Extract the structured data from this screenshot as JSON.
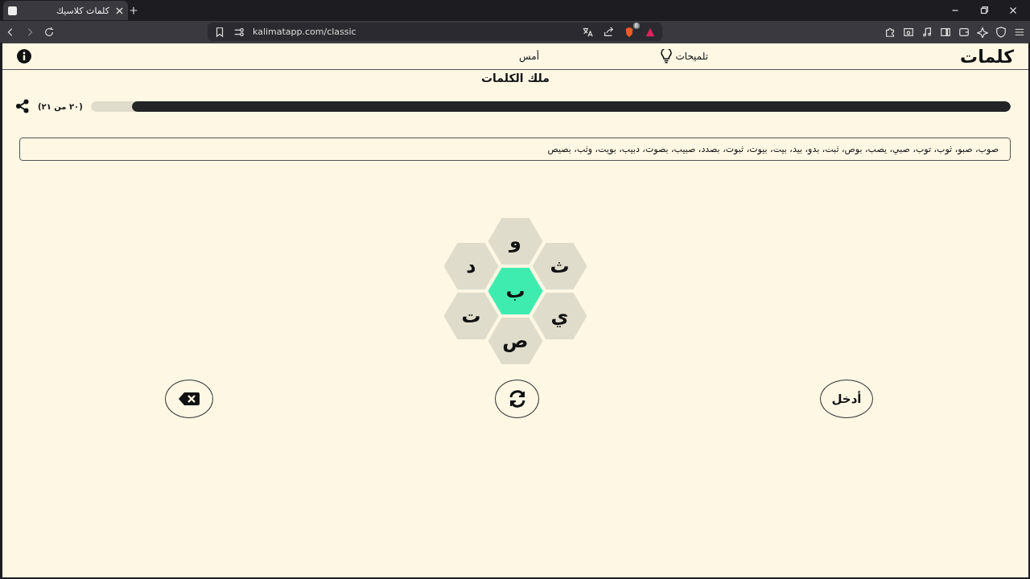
{
  "browser": {
    "tab_title": "كلمات كلاسيك",
    "url": "kalimatapp.com/classic",
    "shield_count": "8"
  },
  "header": {
    "logo": "كلمات",
    "hints": "تلميحات",
    "yesterday": "أمس"
  },
  "rank": {
    "title": "ملك الكلمات",
    "level": 0.955,
    "score": "(٢٠ من ٢١)"
  },
  "found_words": "صوب، صبو، ثوب، توب، صبي، يصب، بوص، ثبت، بدو، بيد، بيت، بيوت، ثبوت، بصدد، صبيب، بصوت، دبيب، بويت، وثب، بصيص",
  "hive": [
    {
      "letter": "و",
      "kind": "outer"
    },
    {
      "letter": "ث",
      "kind": "outer"
    },
    {
      "letter": "د",
      "kind": "outer"
    },
    {
      "letter": "ب",
      "kind": "center"
    },
    {
      "letter": "ي",
      "kind": "outer"
    },
    {
      "letter": "ت",
      "kind": "outer"
    },
    {
      "letter": "ص",
      "kind": "outer"
    }
  ],
  "enter_button": "أدخل"
}
